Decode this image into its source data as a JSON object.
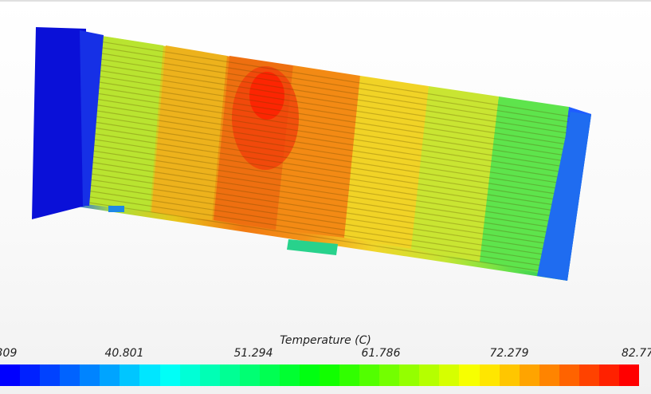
{
  "legend": {
    "title": "Temperature (C)",
    "tick_labels": [
      "309",
      "40.801",
      "51.294",
      "61.786",
      "72.279",
      "82.77"
    ]
  },
  "colors": {
    "min": "#0000ff",
    "max": "#ff0000",
    "colorbar_steps": 32
  }
}
